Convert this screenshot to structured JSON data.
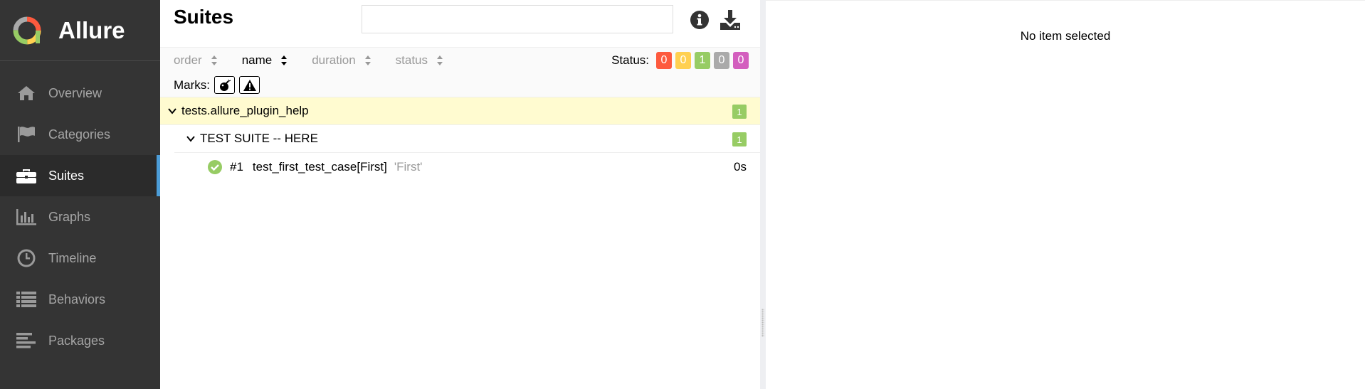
{
  "brand": {
    "name": "Allure"
  },
  "nav": [
    {
      "label": "Overview",
      "icon": "home-icon",
      "active": false
    },
    {
      "label": "Categories",
      "icon": "flag-icon",
      "active": false
    },
    {
      "label": "Suites",
      "icon": "briefcase-icon",
      "active": true
    },
    {
      "label": "Graphs",
      "icon": "bar-chart-icon",
      "active": false
    },
    {
      "label": "Timeline",
      "icon": "clock-icon",
      "active": false
    },
    {
      "label": "Behaviors",
      "icon": "list-icon",
      "active": false
    },
    {
      "label": "Packages",
      "icon": "align-left-icon",
      "active": false
    }
  ],
  "header": {
    "title": "Suites",
    "search_value": ""
  },
  "sorters": [
    {
      "label": "order",
      "active": false
    },
    {
      "label": "name",
      "active": true
    },
    {
      "label": "duration",
      "active": false
    },
    {
      "label": "status",
      "active": false
    }
  ],
  "status": {
    "label": "Status:",
    "counts": [
      {
        "value": "0",
        "color": "#fd5a3e"
      },
      {
        "value": "0",
        "color": "#ffd050"
      },
      {
        "value": "1",
        "color": "#97cc64"
      },
      {
        "value": "0",
        "color": "#aaaaaa"
      },
      {
        "value": "0",
        "color": "#d35ebe"
      }
    ]
  },
  "marks": {
    "label": "Marks:"
  },
  "tree": {
    "root": {
      "name": "tests.allure_plugin_help",
      "count": "1"
    },
    "child": {
      "name": "TEST SUITE -- HERE",
      "count": "1"
    },
    "test": {
      "number": "#1",
      "name": "test_first_test_case[First]",
      "param": "'First'",
      "duration": "0s",
      "status": "passed"
    }
  },
  "detail": {
    "empty_message": "No item selected"
  },
  "colors": {
    "sidebar": "#343434",
    "active_accent": "#4c9dd8",
    "passed": "#97cc64",
    "root_highlight": "#fffbd0"
  }
}
